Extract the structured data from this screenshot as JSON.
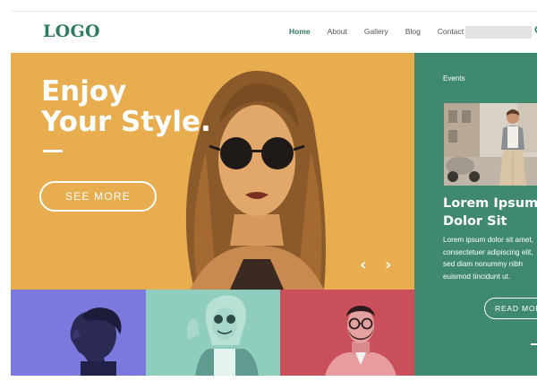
{
  "header": {
    "logo": "LOGO",
    "nav": [
      {
        "label": "Home",
        "active": true
      },
      {
        "label": "About",
        "active": false
      },
      {
        "label": "Gallery",
        "active": false
      },
      {
        "label": "Blog",
        "active": false
      },
      {
        "label": "Contact",
        "active": false
      }
    ],
    "search_icon": "search-icon"
  },
  "hero": {
    "title_line1": "Enjoy",
    "title_line2": "Your Style.",
    "button_label": "SEE MORE",
    "prev_arrow": "‹",
    "next_arrow": "›",
    "background": "#e7ad4e"
  },
  "events": {
    "label": "Events",
    "title_line1": "Lorem Ipsum",
    "title_line2": "Dolor Sit",
    "text_lines": [
      "Lorem ipsum dolor sit amet,",
      "consectetuer adipiscing elit,",
      "sed diam nonummy nibh",
      "euismod tincidunt ut."
    ],
    "button_label": "READ MORE",
    "background": "#3f8a6f"
  },
  "tiles": [
    {
      "color": "#7b79de"
    },
    {
      "color": "#8fcdbf"
    },
    {
      "color": "#c9505b"
    }
  ],
  "colors": {
    "accent": "#2f7a62",
    "hero": "#e7ad4e",
    "panel": "#3f8a6f"
  }
}
